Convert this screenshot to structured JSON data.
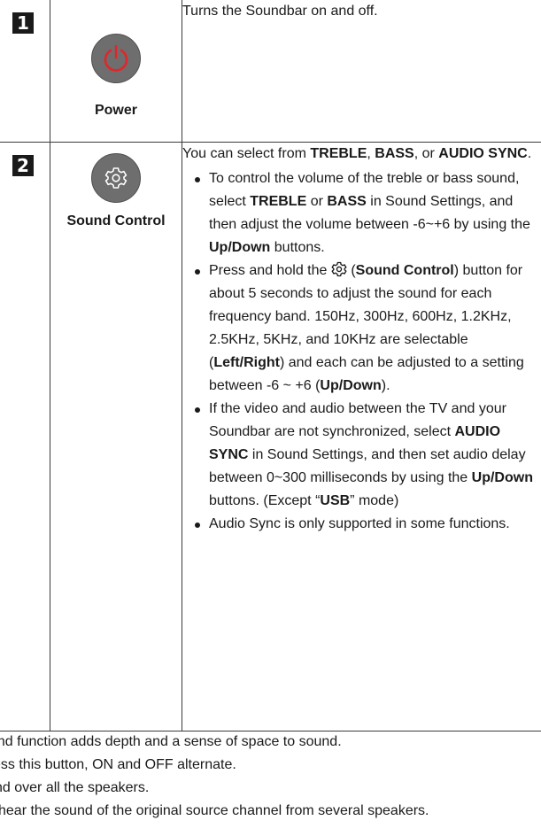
{
  "rows": [
    {
      "number": "1",
      "icon": "power-icon",
      "label": "Power",
      "description": "Turns the Soundbar on and off."
    },
    {
      "number": "2",
      "icon": "gear-icon",
      "label": "Sound Control",
      "intro": {
        "t1": "You can select from ",
        "b1": "TREBLE",
        "t2": ", ",
        "b2": "BASS",
        "t3": ", or ",
        "b3": "AUDIO SYNC",
        "t4": "."
      },
      "bullets": [
        {
          "t1": "To control the volume of the treble or bass sound, select ",
          "b1": "TREBLE",
          "t2": " or ",
          "b2": "BASS",
          "t3": " in Sound Settings, and then adjust the volume between -6~+6 by using the ",
          "b3": "Up/Down",
          "t4": " buttons."
        },
        {
          "t1": "Press and hold the ",
          "t2": " (",
          "b1": "Sound Control",
          "t3": ") button for about 5 seconds to adjust the sound for each frequency band. 150Hz, 300Hz, 600Hz, 1.2KHz, 2.5KHz, 5KHz, and 10KHz are selectable (",
          "b2": "Left/Right",
          "t4": ") and each can be adjusted to a setting between -6 ~ +6 (",
          "b3": "Up/Down",
          "t5": ")."
        },
        {
          "t1": "If the video and audio between the TV and your Soundbar are not synchronized, select ",
          "b1": "AUDIO SYNC",
          "t2": " in Sound Settings, and then set audio delay between 0~300 milliseconds by using the ",
          "b2": "Up/Down",
          "t3": " buttons. (Except “",
          "b3": "USB",
          "t4": "” mode)"
        },
        {
          "t1": "Audio Sync is only supported in some functions."
        }
      ]
    }
  ],
  "bottom_lines": [
    "und function adds depth and a sense of space to sound.",
    "ess this button, ON and OFF alternate.",
    "nd over all the speakers.",
    "hear the sound of the original source channel from several speakers."
  ],
  "colors": {
    "button_fill": "#6e6e6e",
    "power_symbol": "#e0262b",
    "badge": "#1a1a1a",
    "text": "#1a1a1a"
  }
}
